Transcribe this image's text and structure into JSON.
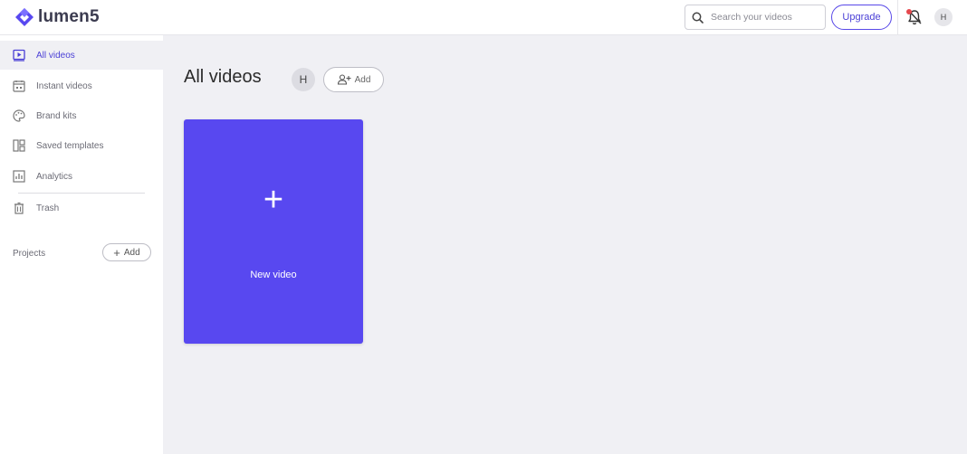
{
  "app": {
    "logo_text": "lumen5",
    "brand_color": "#5848f0"
  },
  "header": {
    "search": {
      "placeholder": "Search your videos",
      "icon": "search-icon"
    },
    "upgrade_label": "Upgrade",
    "notification_icon": "bell-icon",
    "avatar_initial": "H"
  },
  "sidebar": {
    "items": [
      {
        "label": "All videos",
        "icon": "play-square-icon",
        "active": true
      },
      {
        "label": "Instant videos",
        "icon": "calendar-icon",
        "active": false
      },
      {
        "label": "Brand kits",
        "icon": "palette-icon",
        "active": false
      },
      {
        "label": "Saved templates",
        "icon": "template-icon",
        "active": false
      },
      {
        "label": "Analytics",
        "icon": "analytics-icon",
        "active": false
      },
      {
        "label": "Trash",
        "icon": "trash-icon",
        "active": false
      }
    ],
    "projects": {
      "label": "Projects",
      "add_label": "Add"
    }
  },
  "main": {
    "title": "All videos",
    "member_initial": "H",
    "add_member_label": "Add",
    "new_video": {
      "plus": "+",
      "label": "New video"
    }
  }
}
